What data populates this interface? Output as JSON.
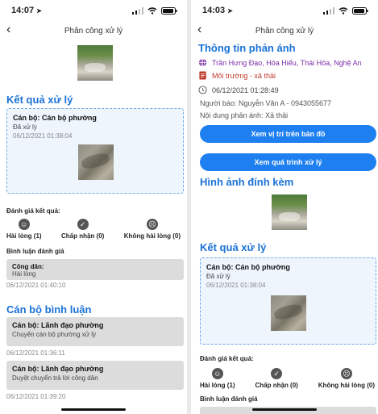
{
  "left": {
    "status_time": "14:07",
    "nav_title": "Phân công xử lý",
    "result_title": "Kết quả xử lý",
    "result_card": {
      "officer": "Cán bộ: Cán bộ phường",
      "status": "Đã xử lý",
      "time": "06/12/2021 01:38:04"
    },
    "rating_title": "Đánh giá kết quả:",
    "ratings": [
      {
        "label": "Hài lòng (1)",
        "icon": "smile-icon"
      },
      {
        "label": "Chấp nhận (0)",
        "icon": "check-icon"
      },
      {
        "label": "Không hài lòng (0)",
        "icon": "frown-icon"
      }
    ],
    "rating_comment_title": "Bình luận đánh giá",
    "citizen_comment": {
      "author": "Công dân:",
      "text": "Hài lòng",
      "time": "06/12/2021 01:40:10"
    },
    "officer_comment_title": "Cán bộ bình luận",
    "officer_comments": [
      {
        "author": "Cán bộ: Lãnh đạo phường",
        "text": "Chuyển cán bộ phường xử lý",
        "time": "06/12/2021 01:36:11"
      },
      {
        "author": "Cán bộ: Lãnh đạo phường",
        "text": "Duyệt chuyển trả lời công dân",
        "time": "06/12/2021 01:39:20"
      }
    ]
  },
  "right": {
    "status_time": "14:03",
    "nav_title": "Phân công xử lý",
    "info_title": "Thông tin phản ánh",
    "address": "Trần Hưng Đạo, Hòa Hiếu, Thái Hòa, Nghệ An",
    "category": "Môi trường - xả thải",
    "datetime": "06/12/2021 01:28:49",
    "reporter": "Người báo: Nguyễn Văn A - 0943055677",
    "content": "Nội dung phản ánh: Xả thải",
    "btn_map": "Xem vị trí trên bản đồ",
    "btn_process": "Xem quá trình xử lý",
    "attach_title": "Hình ảnh đính kèm",
    "result_title": "Kết quả xử lý",
    "result_card": {
      "officer": "Cán bộ: Cán bộ phường",
      "status": "Đã xử lý",
      "time": "06/12/2021 01:38:04"
    },
    "rating_title": "Đánh giá kết quả:",
    "ratings": [
      {
        "label": "Hài lòng (1)",
        "icon": "smile-icon"
      },
      {
        "label": "Chấp nhận (0)",
        "icon": "check-icon"
      },
      {
        "label": "Không hài lòng (0)",
        "icon": "frown-icon"
      }
    ],
    "rating_comment_title": "Bình luận đánh giá"
  },
  "colors": {
    "accent": "#1a72d6",
    "button": "#1e7ff0",
    "address": "#7b2fa8",
    "category": "#c0392b"
  }
}
